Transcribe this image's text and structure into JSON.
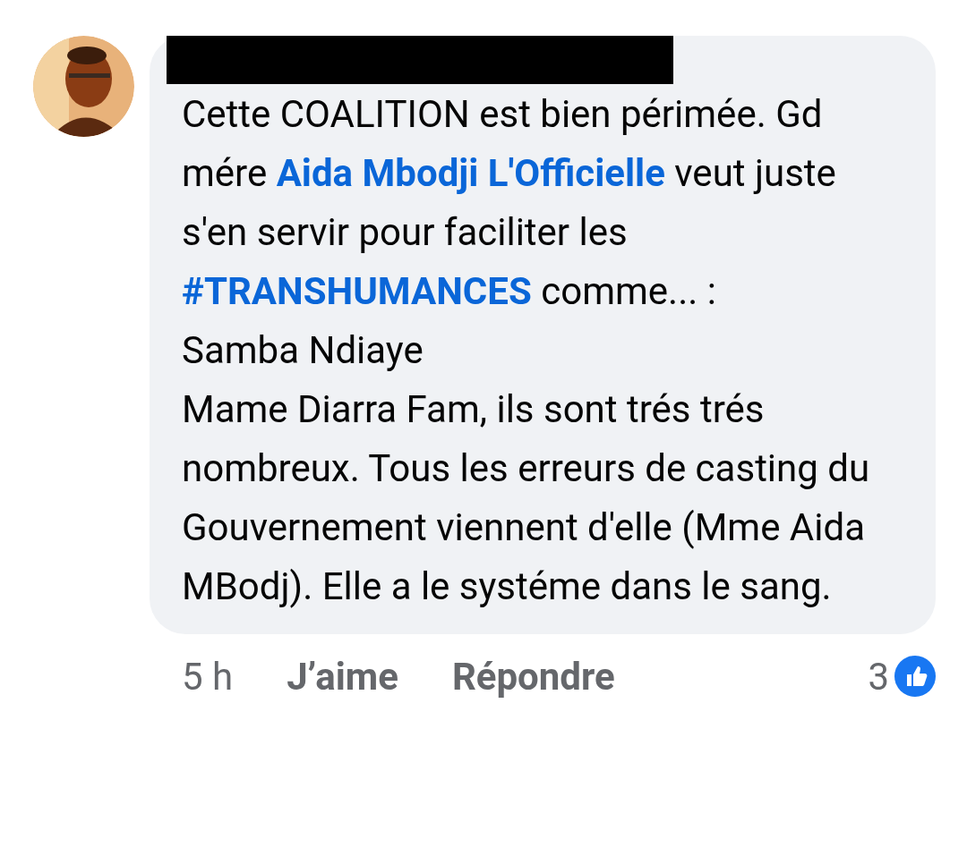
{
  "comment": {
    "body": [
      {
        "kind": "text",
        "text": "Cette COALITION est bien périmée. Gd mére "
      },
      {
        "kind": "link",
        "text": "Aida Mbodji L'Officielle"
      },
      {
        "kind": "text",
        "text": " veut juste s'en servir pour faciliter les "
      },
      {
        "kind": "link",
        "text": "#TRANSHUMANCES"
      },
      {
        "kind": "text",
        "text": " comme... :\nSamba Ndiaye\nMame Diarra Fam, ils sont trés trés nombreux. Tous les erreurs de casting du Gouvernement viennent d'elle (Mme Aida MBodj). Elle a le systéme dans le sang."
      }
    ],
    "time": "5 h",
    "actions": [
      "J’aime",
      "Répondre"
    ],
    "reaction_count": "3"
  }
}
